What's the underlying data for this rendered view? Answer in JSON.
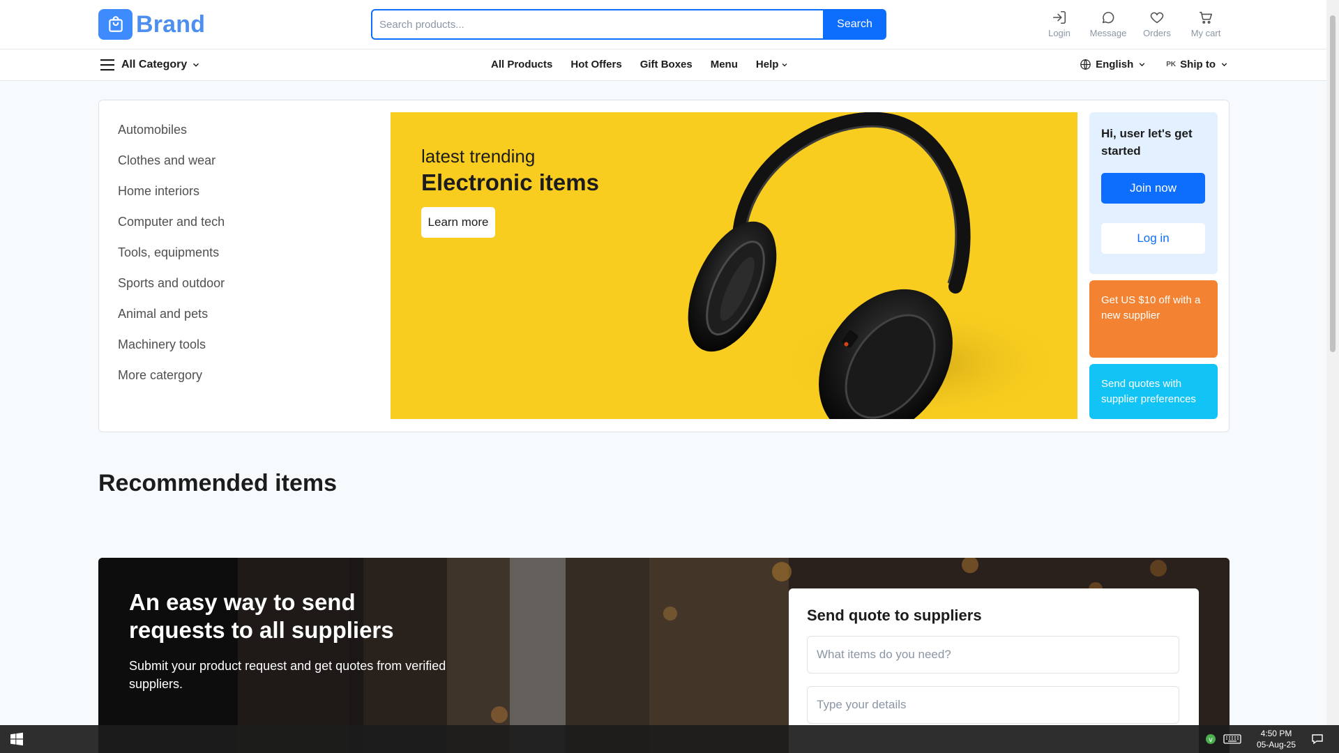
{
  "header": {
    "brand": "Brand",
    "search_placeholder": "Search products...",
    "search_button": "Search",
    "actions": [
      {
        "label": "Login",
        "icon": "login-icon"
      },
      {
        "label": "Message",
        "icon": "message-icon"
      },
      {
        "label": "Orders",
        "icon": "heart-icon"
      },
      {
        "label": "My cart",
        "icon": "cart-icon"
      }
    ]
  },
  "nav": {
    "all_category": "All Category",
    "links": [
      "All Products",
      "Hot Offers",
      "Gift Boxes",
      "Menu",
      "Help"
    ],
    "language": "English",
    "country_code": "PK",
    "ship_to": "Ship to"
  },
  "categories": [
    "Automobiles",
    "Clothes and wear",
    "Home interiors",
    "Computer and tech",
    "Tools, equipments",
    "Sports and outdoor",
    "Animal and pets",
    "Machinery tools",
    "More catergory"
  ],
  "hero": {
    "subtitle": "latest trending",
    "title": "Electronic items",
    "button": "Learn more"
  },
  "user_card": {
    "greeting": "Hi, user let's get started",
    "join": "Join now",
    "login": "Log in"
  },
  "promos": [
    {
      "text": "Get US $10 off with a new supplier",
      "color": "#f38332"
    },
    {
      "text": "Send quotes with supplier preferences",
      "color": "#12c4f5"
    }
  ],
  "recommended_title": "Recommended items",
  "quote_section": {
    "title": "An easy way to send requests to all suppliers",
    "description": "Submit your product request and get quotes from verified suppliers.",
    "form_title": "Send quote to suppliers",
    "item_placeholder": "What items do you need?",
    "details_placeholder": "Type your details"
  },
  "taskbar": {
    "time": "4:50 PM",
    "date": "05-Aug-25"
  },
  "colors": {
    "primary": "#0d6efd",
    "brand": "#4c8ff0",
    "hero_bg": "#f9cd1f"
  }
}
